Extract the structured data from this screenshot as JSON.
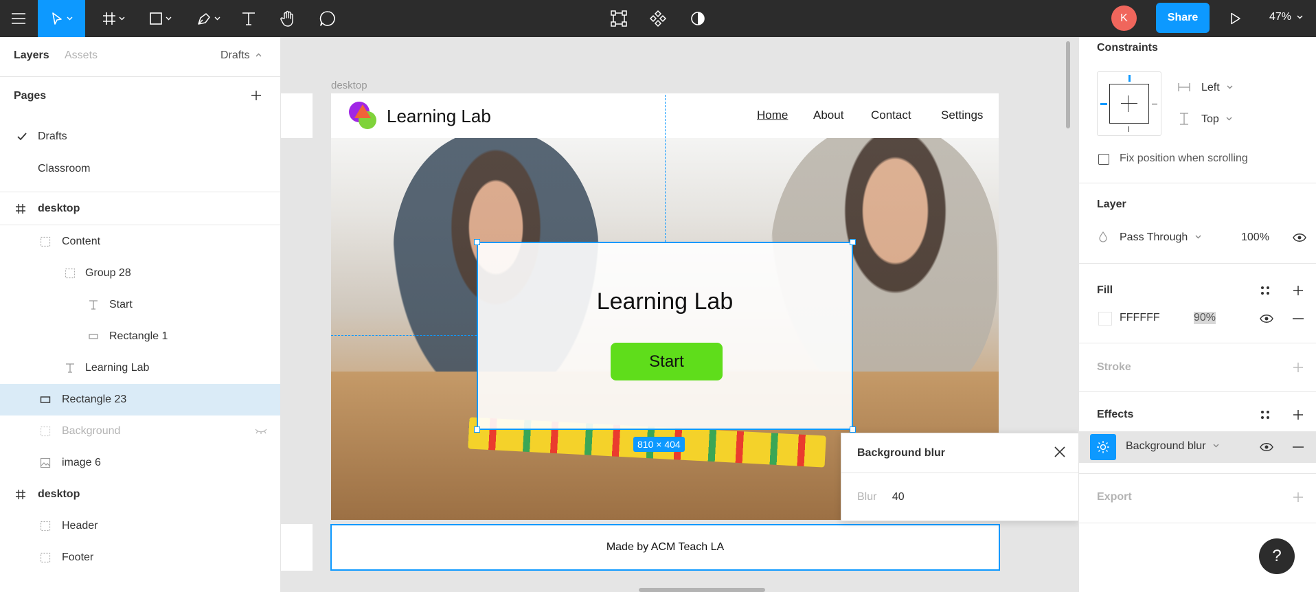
{
  "toolbar": {
    "avatar_initial": "K",
    "share_label": "Share",
    "zoom": "47%"
  },
  "left_panel": {
    "tabs": {
      "layers": "Layers",
      "assets": "Assets",
      "page_dropdown": "Drafts"
    },
    "pages_title": "Pages",
    "pages": [
      "Drafts",
      "Classroom"
    ],
    "layers": {
      "frame1": "desktop",
      "content": "Content",
      "group28": "Group 28",
      "start": "Start",
      "rect1": "Rectangle 1",
      "learning_lab": "Learning Lab",
      "rect23": "Rectangle 23",
      "background": "Background",
      "image6": "image 6",
      "frame2": "desktop",
      "header": "Header",
      "footer": "Footer"
    }
  },
  "canvas": {
    "frame_label": "desktop",
    "brand": "Learning Lab",
    "nav": [
      "Home",
      "About",
      "Contact",
      "Settings"
    ],
    "card_title": "Learning Lab",
    "start_button": "Start",
    "dimensions": "810 × 404",
    "footer_text": "Made by ACM Teach LA"
  },
  "blur_popup": {
    "title": "Background blur",
    "blur_label": "Blur",
    "blur_value": "40"
  },
  "right_panel": {
    "constraints_title": "Constraints",
    "horizontal": "Left",
    "vertical": "Top",
    "fix_position": "Fix position when scrolling",
    "layer_title": "Layer",
    "blend_mode": "Pass Through",
    "layer_opacity": "100%",
    "fill_title": "Fill",
    "fill_hex": "FFFFFF",
    "fill_opacity": "90%",
    "stroke_title": "Stroke",
    "effects_title": "Effects",
    "effect_type": "Background blur",
    "export_title": "Export"
  },
  "help_label": "?",
  "colors": {
    "accent": "#0d99ff",
    "toolbar": "#2c2c2c",
    "start_button": "#5fdd1b",
    "avatar": "#f0665c"
  }
}
